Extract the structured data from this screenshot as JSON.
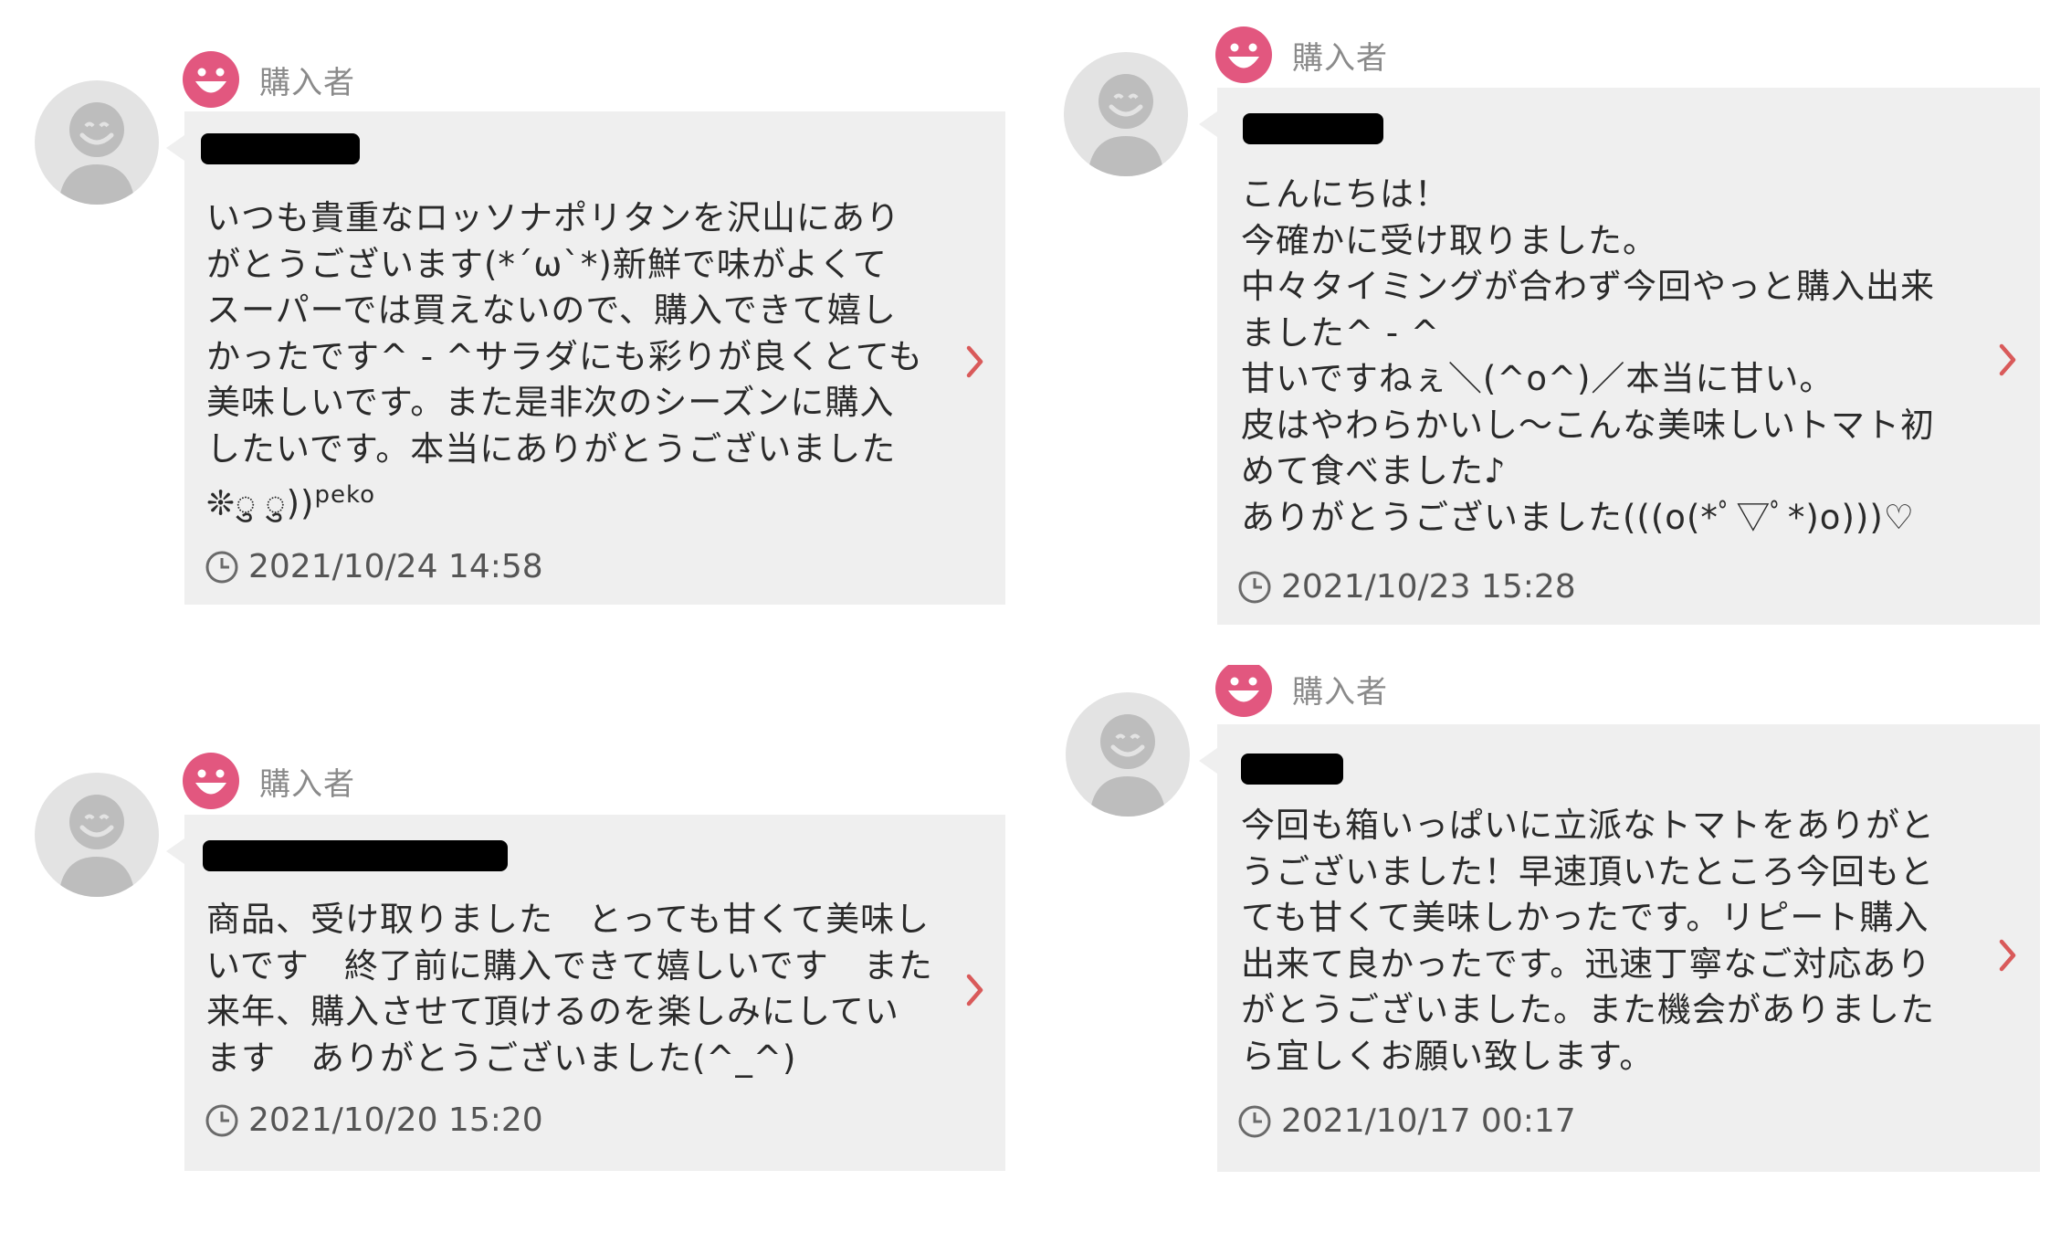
{
  "colors": {
    "accent": "#e2577f",
    "chevron": "#d95a5a",
    "bubble": "#efefef",
    "avatar": "#e3e3e3"
  },
  "reviews": [
    {
      "role": "購入者",
      "message": "いつも貴重なロッソナポリタンを沢山にあり\nがとうございます(*´ω`*)新鮮で味がよくて\nスーパーでは買えないので、購入できて嬉し\nかったです^ - ^サラダにも彩りが良くとても\n美味しいです。また是非次のシーズンに購入\nしたいです。本当にありがとうございました\n❊ु ु))",
      "message_suffix": "peko",
      "datetime": "2021/10/24 14:58"
    },
    {
      "role": "購入者",
      "message": "こんにちは！\n今確かに受け取りました。\n中々タイミングが合わず今回やっと購入出来\nました^ - ^\n甘いですねぇ＼(^o^)／本当に甘い。\n皮はやわらかいし〜こんな美味しいトマト初\nめて食べました♪\nありがとうございました(((o(*ﾟ▽ﾟ*)o)))♡",
      "datetime": "2021/10/23 15:28"
    },
    {
      "role": "購入者",
      "message": "商品、受け取りました　とっても甘くて美味し\nいです　終了前に購入できて嬉しいです　また\n来年、購入させて頂けるのを楽しみにしてい\nます　ありがとうございました(^_^)",
      "datetime": "2021/10/20 15:20"
    },
    {
      "role": "購入者",
      "message": "今回も箱いっぱいに立派なトマトをありがと\nうございました！早速頂いたところ今回もと\nても甘くて美味しかったです。リピート購入\n出来て良かったです。迅速丁寧なご対応あり\nがとうございました。また機会がありました\nら宜しくお願い致します。",
      "datetime": "2021/10/17 00:17"
    }
  ]
}
